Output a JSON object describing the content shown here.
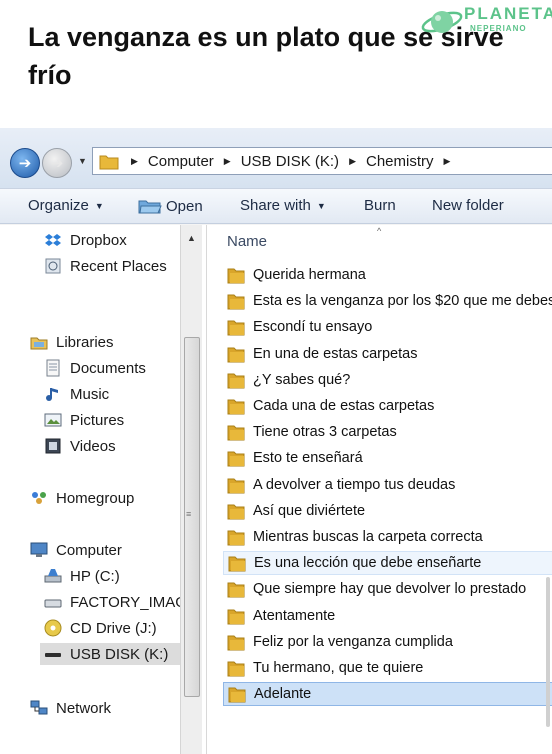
{
  "caption": "La venganza es un plato que se sirve frío",
  "watermark": {
    "line1": "PLANETA",
    "line2": "NEPERIANO"
  },
  "address": {
    "crumbs": [
      "Computer",
      "USB DISK (K:)",
      "Chemistry"
    ]
  },
  "toolbar": {
    "organize": "Organize",
    "open": "Open",
    "share_with": "Share with",
    "burn": "Burn",
    "new_folder": "New folder"
  },
  "nav": {
    "dropbox": "Dropbox",
    "recent_places": "Recent Places",
    "libraries": "Libraries",
    "documents": "Documents",
    "music": "Music",
    "pictures": "Pictures",
    "videos": "Videos",
    "homegroup": "Homegroup",
    "computer": "Computer",
    "hp": "HP (C:)",
    "factory": "FACTORY_IMAGI",
    "cd_drive": "CD Drive (J:)",
    "usb_disk": "USB DISK (K:)",
    "network": "Network"
  },
  "filelist": {
    "column_name": "Name",
    "items": [
      "Querida hermana",
      "Esta es la venganza por los $20 que me debes",
      "Escondí tu ensayo",
      "En una de estas carpetas",
      "¿Y sabes qué?",
      "Cada una de estas carpetas",
      "Tiene otras 3 carpetas",
      "Esto te enseñará",
      "A devolver a tiempo tus deudas",
      "Así que diviértete",
      "Mientras buscas la carpeta correcta",
      "Es una lección que debe enseñarte",
      "Que siempre hay que devolver lo prestado",
      "Atentamente",
      "Feliz por la venganza cumplida",
      "Tu hermano, que te quiere",
      "Adelante"
    ],
    "hover_index": 11,
    "selected_index": 16
  },
  "colors": {
    "folder": "#e8b83a",
    "selection": "#cde1f7",
    "accent": "#1e5aa8",
    "watermark": "#5cc38a"
  }
}
